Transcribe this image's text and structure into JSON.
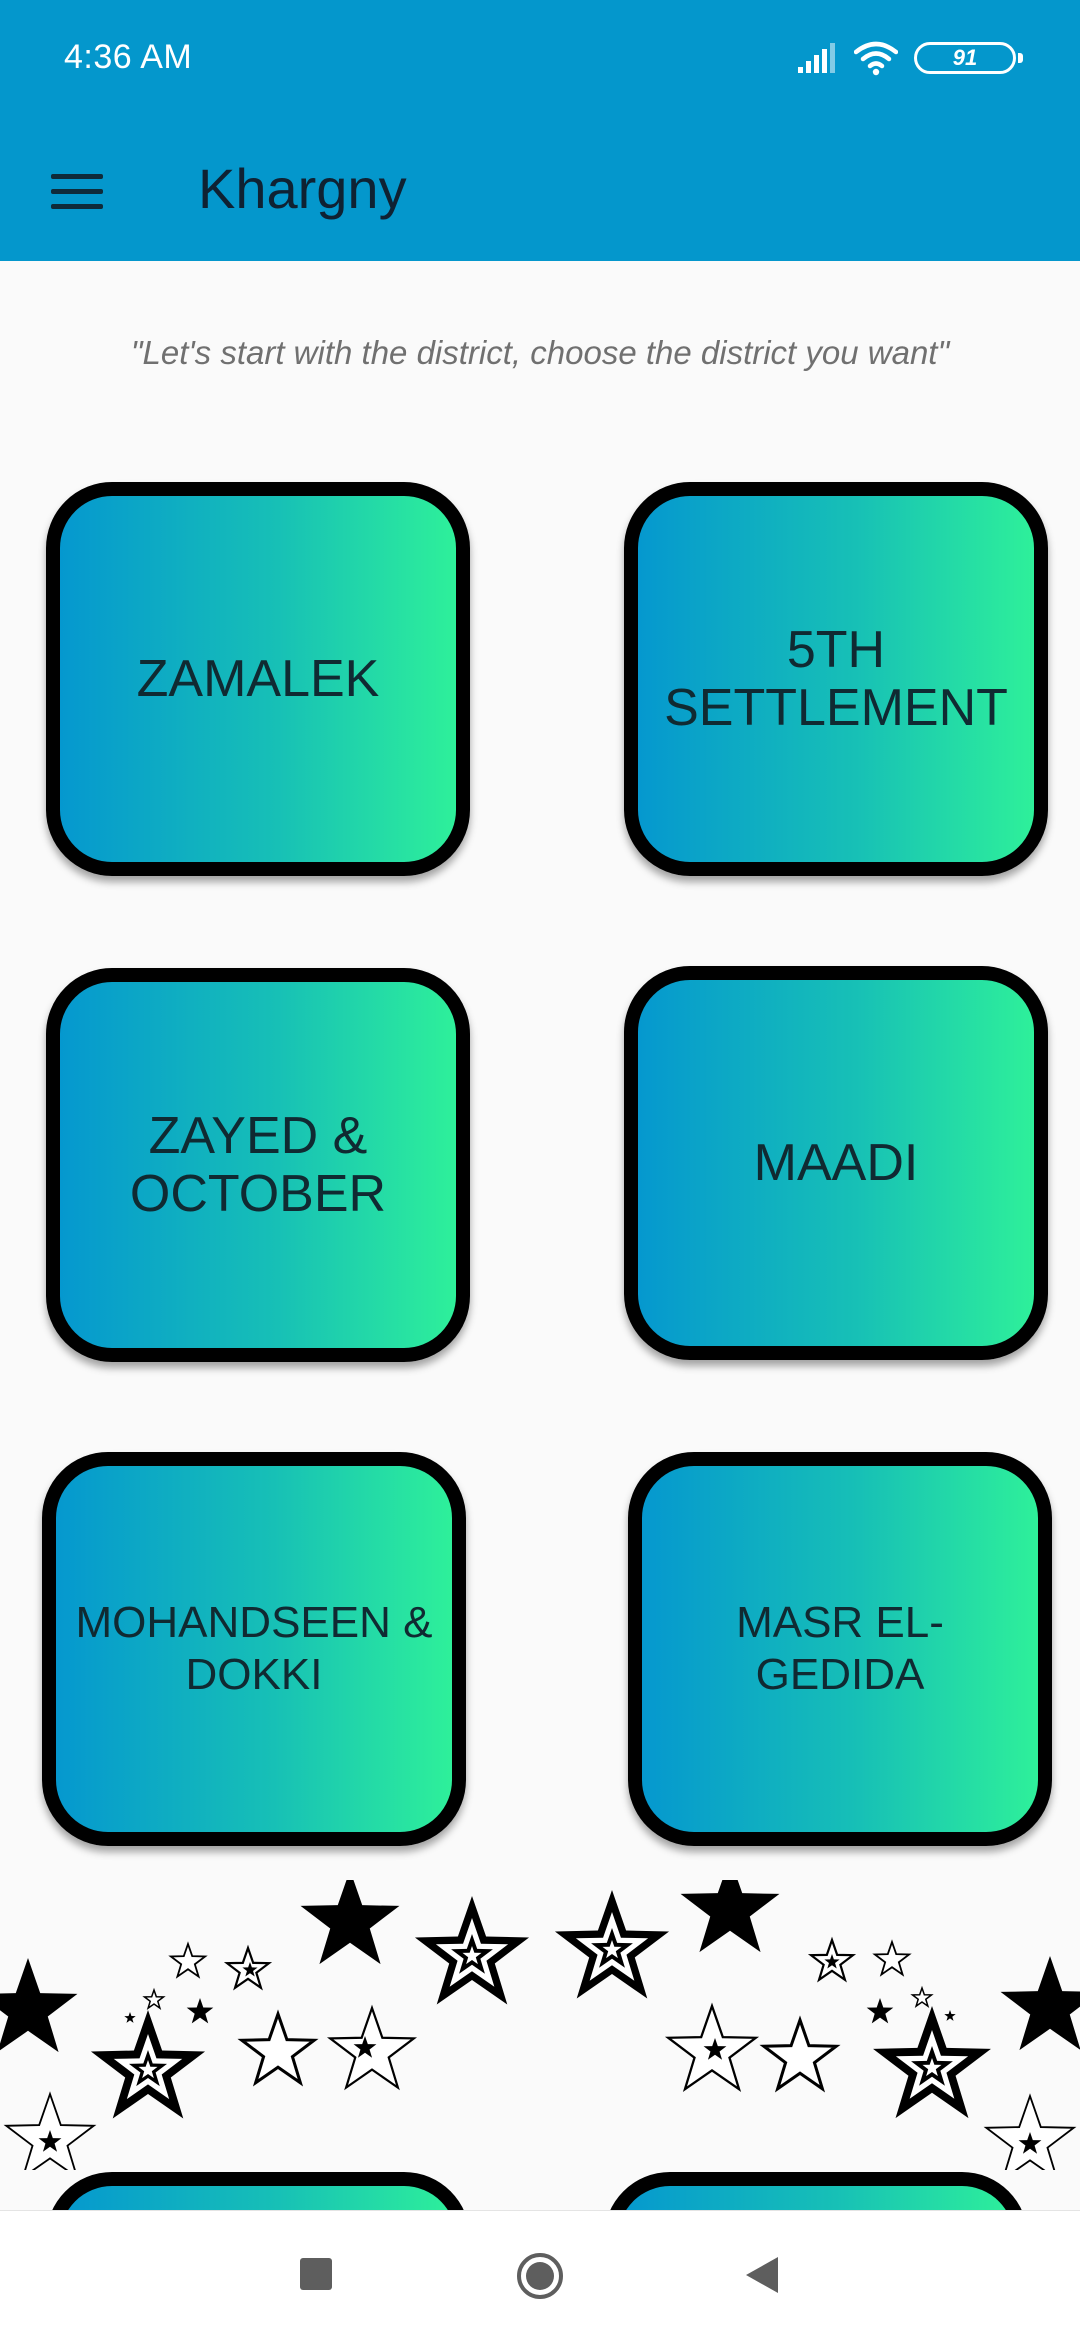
{
  "status_bar": {
    "time": "4:36 AM",
    "battery": "91"
  },
  "app_bar": {
    "title": "Khargny",
    "menu_icon": "menu-icon"
  },
  "subtitle": "\"Let's start with the district, choose the district you want\"",
  "districts": [
    {
      "label": "ZAMALEK"
    },
    {
      "label": "5TH\nSETTLEMENT"
    },
    {
      "label": "ZAYED &\nOCTOBER"
    },
    {
      "label": "MAADI"
    },
    {
      "label": "MOHANDSEEN &\nDOKKI"
    },
    {
      "label": "MASR EL-GEDIDA"
    }
  ],
  "decoration": {
    "icon": "stars-decoration"
  },
  "nav_bar": {
    "icons": [
      "recents-square-icon",
      "home-circle-icon",
      "back-triangle-icon"
    ]
  },
  "colors": {
    "app_bar": "#0497cc",
    "card_gradient_start": "#0598cf",
    "card_gradient_end": "#2ef09a",
    "card_border": "#000000",
    "card_text": "#102a32",
    "background": "#fafafa"
  }
}
